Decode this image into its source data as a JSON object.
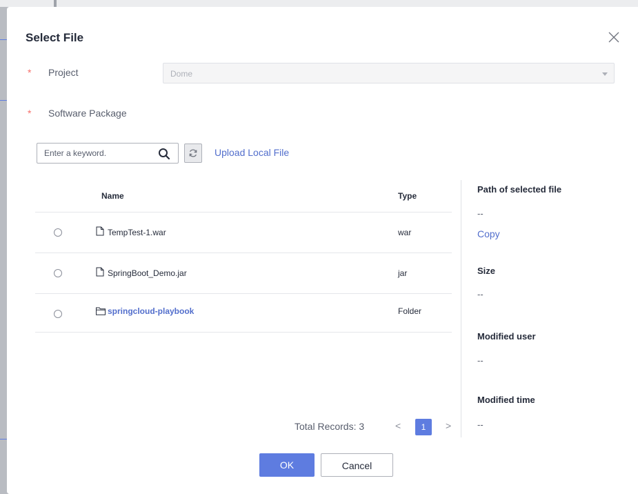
{
  "dialog": {
    "title": "Select File",
    "close_icon": "close-icon"
  },
  "form": {
    "project_label": "Project",
    "project_value": "Dome",
    "package_label": "Software Package",
    "required_mark": "*"
  },
  "toolbar": {
    "search_placeholder": "Enter a keyword.",
    "search_icon": "search-icon",
    "refresh_icon": "refresh-icon",
    "upload_label": "Upload Local File"
  },
  "table": {
    "columns": [
      "Name",
      "Type"
    ],
    "rows": [
      {
        "name": "TempTest-1.war",
        "type": "war",
        "icon": "file-icon",
        "selected": false
      },
      {
        "name": "SpringBoot_Demo.jar",
        "type": "jar",
        "icon": "file-icon",
        "selected": false
      },
      {
        "name": "springcloud-playbook",
        "type": "Folder",
        "icon": "folder-icon",
        "selected": false
      }
    ]
  },
  "details": {
    "path_label": "Path of selected file",
    "path_value": "--",
    "copy_label": "Copy",
    "size_label": "Size",
    "size_value": "--",
    "user_label": "Modified user",
    "user_value": "--",
    "time_label": "Modified time",
    "time_value": "--"
  },
  "pagination": {
    "total_label": "Total Records: 3",
    "prev": "<",
    "current_page": "1",
    "next": ">"
  },
  "buttons": {
    "ok": "OK",
    "cancel": "Cancel"
  },
  "colors": {
    "accent": "#5e7ce0",
    "link": "#526ecc",
    "required": "#f66f6a"
  }
}
